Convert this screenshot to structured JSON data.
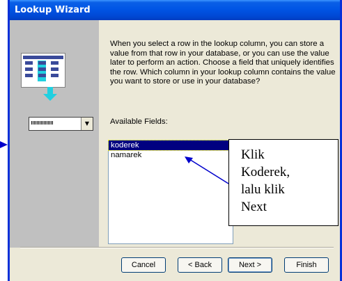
{
  "window": {
    "title": "Lookup Wizard"
  },
  "illustration": {
    "combo_placeholder": "xxxxxx"
  },
  "instructions": {
    "text": "When you select a row in the lookup column, you can store a value from that row in your database, or you can use the value later to perform an action.  Choose a field that uniquely identifies the row. Which column in your lookup column contains the value you want to store or use in your database?"
  },
  "fields": {
    "label": "Available Fields:",
    "items": [
      "koderek",
      "namarek"
    ],
    "selected": "koderek"
  },
  "buttons": {
    "cancel": "Cancel",
    "back": "< Back",
    "next": "Next >",
    "finish": "Finish"
  },
  "callout": {
    "lines": [
      "Klik",
      "Koderek,",
      "lalu klik",
      "Next"
    ]
  },
  "colors": {
    "title_bar": "#0055e5",
    "left_panel": "#c0c0c0",
    "selection": "#000080",
    "callout_arrow": "#0000cc"
  }
}
